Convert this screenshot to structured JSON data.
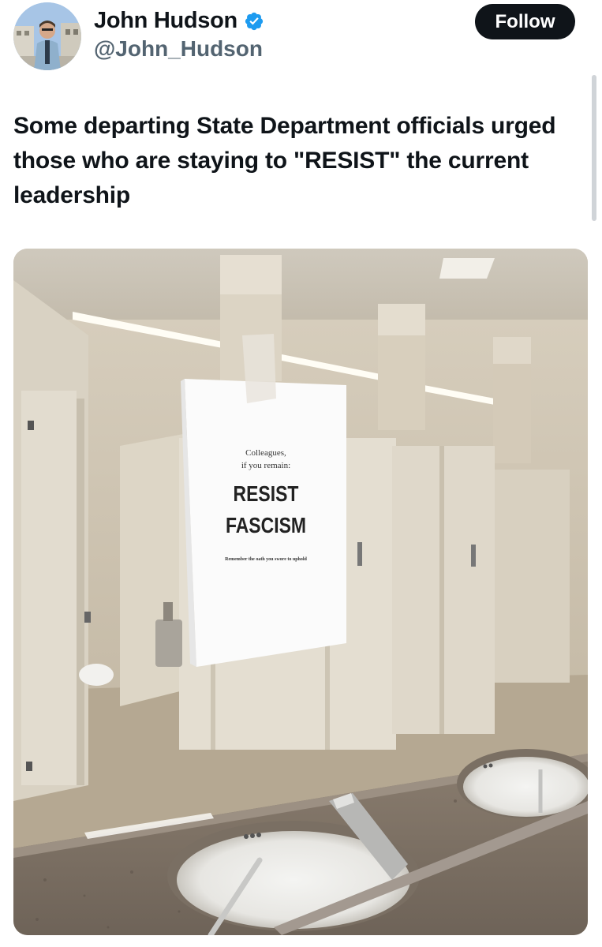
{
  "author": {
    "display_name": "John Hudson",
    "handle": "@John_Hudson",
    "verified": true,
    "verified_color": "#1d9bf0",
    "avatar_icon": "profile-photo"
  },
  "actions": {
    "follow_label": "Follow"
  },
  "tweet": {
    "text": "Some departing State Department officials urged those who are staying to \"RESIST\" the current leadership"
  },
  "media": {
    "sign": {
      "line1": "Colleagues,",
      "line2": "if you remain:",
      "line3": "RESIST",
      "line4": "FASCISM",
      "footer": "Remember the oath you swore to uphold"
    }
  },
  "colors": {
    "text_primary": "#0f1419",
    "text_secondary": "#536471",
    "follow_bg": "#0f1419",
    "follow_text": "#ffffff"
  }
}
